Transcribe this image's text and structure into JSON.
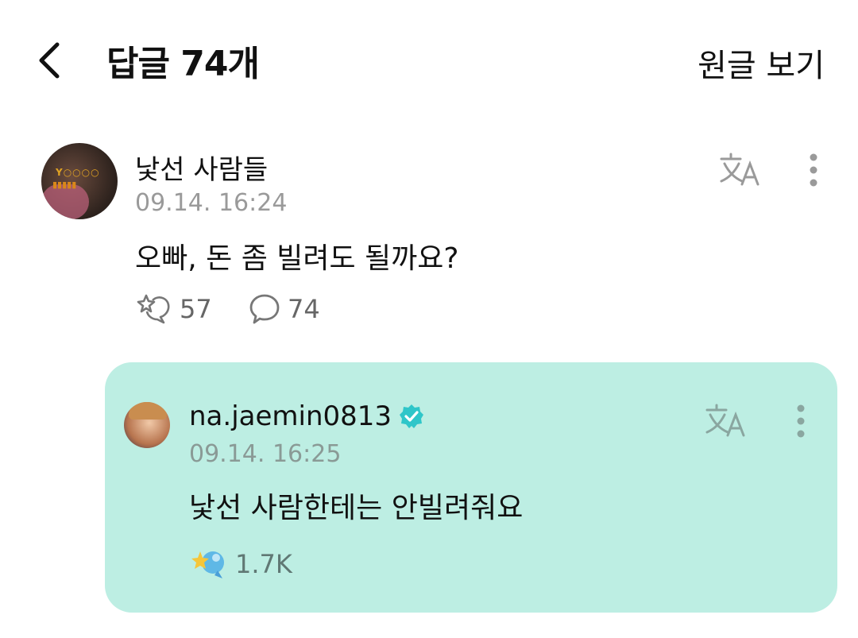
{
  "header": {
    "title": "답글 74개",
    "view_original": "원글 보기"
  },
  "comment": {
    "author": "낯선 사람들",
    "timestamp": "09.14. 16:24",
    "body": "오빠, 돈 좀 빌려도 될까요?",
    "likes": "57",
    "replies": "74"
  },
  "reply": {
    "author": "na.jaemin0813",
    "timestamp": "09.14. 16:25",
    "body": "낯선 사람한테는 안빌려줘요",
    "likes": "1.7K",
    "card_color": "#bdeee3",
    "verified_color": "#2fc6c9"
  }
}
